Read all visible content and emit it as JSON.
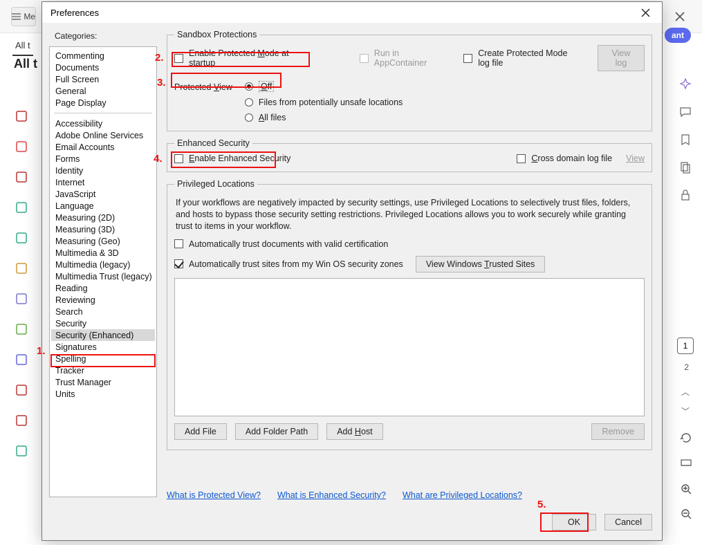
{
  "bg": {
    "menu_label": "Me",
    "all_tools_tab": "All t",
    "heading": "All t",
    "ai_pill": "ant",
    "page_current": "1",
    "page_next": "2"
  },
  "dialog": {
    "title": "Preferences",
    "categories_label": "Categories:",
    "categories_top": [
      "Commenting",
      "Documents",
      "Full Screen",
      "General",
      "Page Display"
    ],
    "categories_bottom": [
      "Accessibility",
      "Adobe Online Services",
      "Email Accounts",
      "Forms",
      "Identity",
      "Internet",
      "JavaScript",
      "Language",
      "Measuring (2D)",
      "Measuring (3D)",
      "Measuring (Geo)",
      "Multimedia & 3D",
      "Multimedia (legacy)",
      "Multimedia Trust (legacy)",
      "Reading",
      "Reviewing",
      "Search",
      "Security",
      "Security (Enhanced)",
      "Signatures",
      "Spelling",
      "Tracker",
      "Trust Manager",
      "Units"
    ],
    "selected_category": "Security (Enhanced)",
    "sandbox": {
      "legend": "Sandbox Protections",
      "enable_protected": "Enable Protected Mode at startup",
      "enable_protected_underline": "M",
      "run_appcontainer": "Run in AppContainer",
      "create_logfile": "Create Protected Mode log file",
      "view_log": "View log",
      "protected_view_label": "Protected View",
      "protected_view_underline": "V",
      "pv_off": "Off",
      "pv_off_underline": "O",
      "pv_unsafe": "Files from potentially unsafe locations",
      "pv_all": "All files",
      "pv_all_underline": "A"
    },
    "enhanced": {
      "legend": "Enhanced Security",
      "enable": "Enable Enhanced Security",
      "enable_underline": "E",
      "cross_log": "Cross domain log file",
      "cross_log_underline": "C",
      "view": "View"
    },
    "priv": {
      "legend": "Privileged Locations",
      "desc": "If your workflows are negatively impacted by security settings, use Privileged Locations to selectively trust files, folders, and hosts to bypass those security setting restrictions. Privileged Locations allows you to work securely while granting trust to items in your workflow.",
      "auto_cert": "Automatically trust documents with valid certification",
      "auto_sites": "Automatically trust sites from my Win OS security zones",
      "view_trusted": "View Windows Trusted Sites",
      "view_trusted_underline": "T",
      "add_file": "Add File",
      "add_folder": "Add Folder Path",
      "add_host": "Add Host",
      "add_host_underline": "H",
      "remove": "Remove"
    },
    "help": {
      "protected": "What is Protected View?",
      "enhanced": "What is Enhanced Security?",
      "priv": "What are Privileged Locations?"
    },
    "ok": "OK",
    "cancel": "Cancel"
  },
  "annotations": {
    "n1": "1.",
    "n2": "2.",
    "n3": "3.",
    "n4": "4.",
    "n5": "5."
  }
}
